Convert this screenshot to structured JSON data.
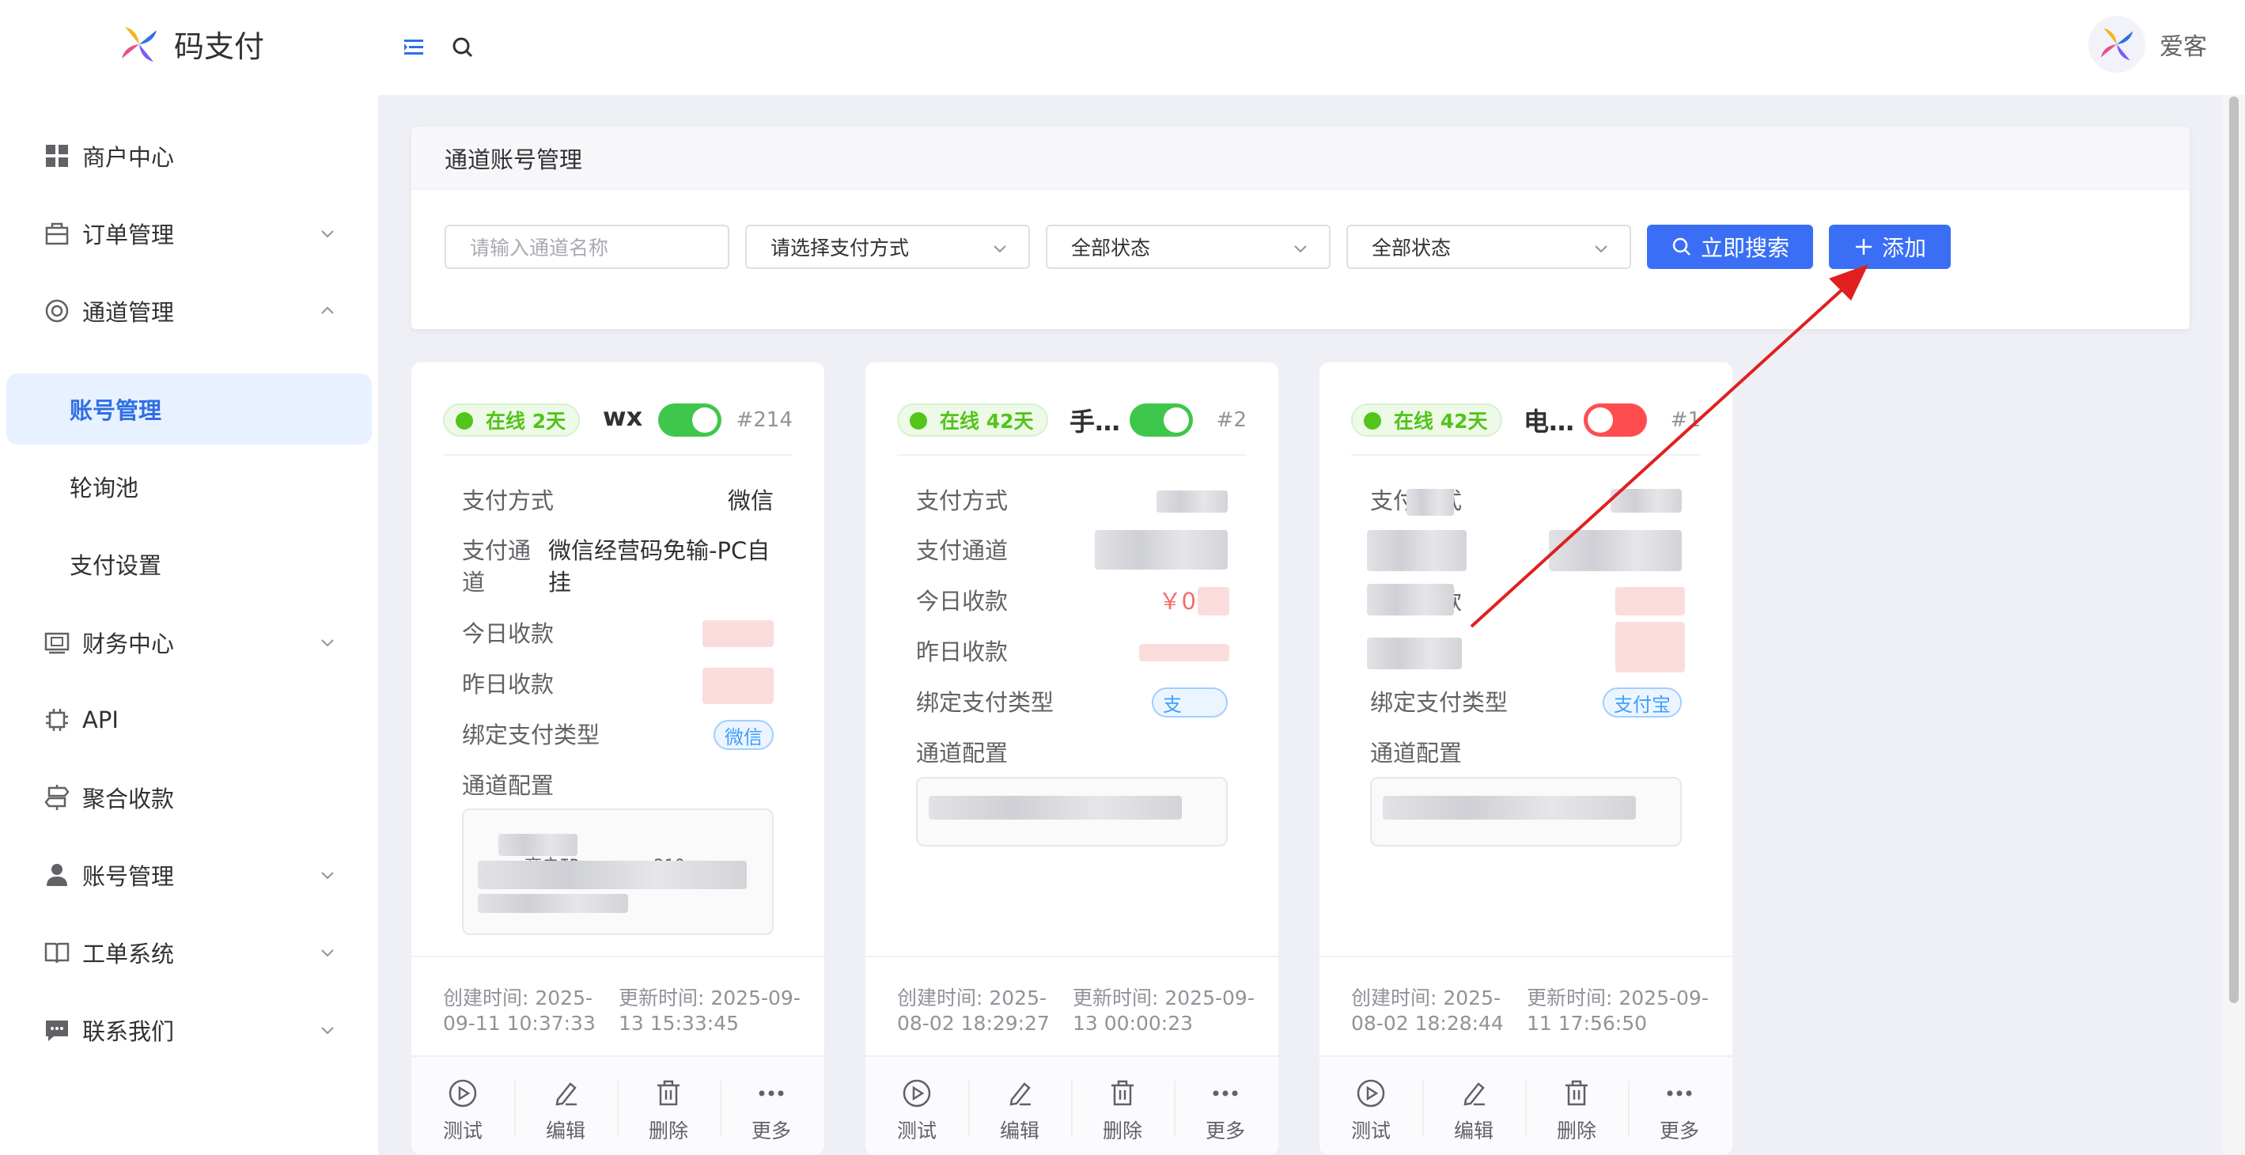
{
  "app": {
    "logo_text": "码支付",
    "user_name": "爱客"
  },
  "sidebar": {
    "items": [
      {
        "label": "商户中心",
        "icon": "grid-icon"
      },
      {
        "label": "订单管理",
        "icon": "bag-icon"
      },
      {
        "label": "通道管理",
        "icon": "lifebuoy-icon"
      },
      {
        "label": "账号管理"
      },
      {
        "label": "轮询池"
      },
      {
        "label": "支付设置"
      },
      {
        "label": "财务中心",
        "icon": "wallet-icon"
      },
      {
        "label": "API",
        "icon": "chip-icon"
      },
      {
        "label": "聚合收款",
        "icon": "signpost-icon"
      },
      {
        "label": "账号管理",
        "icon": "user-icon"
      },
      {
        "label": "工单系统",
        "icon": "book-icon"
      },
      {
        "label": "联系我们",
        "icon": "chat-icon"
      }
    ]
  },
  "filter": {
    "panel_title": "通道账号管理",
    "name_placeholder": "请输入通道名称",
    "pay_method_placeholder": "请选择支付方式",
    "status1": "全部状态",
    "status2": "全部状态",
    "search_label": "立即搜索",
    "add_label": "添加"
  },
  "labels": {
    "pay_method": "支付方式",
    "pay_channel": "支付通道",
    "today": "今日收款",
    "yesterday": "昨日收款",
    "bind_type": "绑定支付类型",
    "config": "通道配置",
    "test": "测试",
    "edit": "编辑",
    "delete": "删除",
    "more": "更多"
  },
  "cards": [
    {
      "status": "在线 2天",
      "name": "wx",
      "id": "#214",
      "enabled": true,
      "pay_method": "微信",
      "channel": "微信经营码免输-PC自挂",
      "bind_tag": "微信",
      "config_line1": "商户ID       210",
      "created": "创建时间: 2025-09-11 10:37:33",
      "updated": "更新时间: 2025-09-13 15:33:45"
    },
    {
      "status": "在线 42天",
      "name": "手…",
      "id": "#2",
      "enabled": true,
      "today_prefix": "￥0",
      "bind_tag": "支",
      "created": "创建时间: 2025-08-02 18:29:27",
      "updated": "更新时间: 2025-09-13 00:00:23"
    },
    {
      "status": "在线 42天",
      "name": "电…",
      "id": "#1",
      "enabled": false,
      "bind_tag": "支付宝",
      "created": "创建时间: 2025-08-02 18:28:44",
      "updated": "更新时间: 2025-09-11 17:56:50"
    }
  ],
  "colors": {
    "primary": "#3a6ff5",
    "online": "#52c41a",
    "toggle_on": "#3ec74b",
    "toggle_off": "#ff4d4f",
    "money": "#f56c6c",
    "annotation_arrow": "#e02020"
  }
}
